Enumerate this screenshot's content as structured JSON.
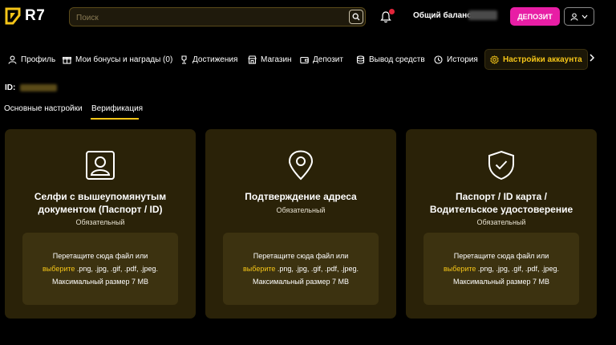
{
  "header": {
    "logo_text": "R7",
    "search_placeholder": "Поиск",
    "balance_label": "Общий баланс:",
    "deposit_label": "ДЕПОЗИТ"
  },
  "nav": {
    "items": [
      {
        "label": "Профиль",
        "icon": "user-icon"
      },
      {
        "label": "Мои бонусы и награды (0)",
        "icon": "gift-icon"
      },
      {
        "label": "Достижения",
        "icon": "trophy-icon"
      },
      {
        "label": "Магазин",
        "icon": "shop-icon"
      },
      {
        "label": "Депозит",
        "icon": "wallet-icon"
      },
      {
        "label": "Вывод средств",
        "icon": "coins-icon"
      },
      {
        "label": "История",
        "icon": "history-icon"
      },
      {
        "label": "Настройки аккаунта",
        "icon": "settings-icon",
        "active": true
      }
    ]
  },
  "account": {
    "id_label": "ID:"
  },
  "tabs": [
    {
      "label": "Основные настройки",
      "active": false
    },
    {
      "label": "Верификация",
      "active": true
    }
  ],
  "cards": [
    {
      "icon": "selfie-icon",
      "title_line1": "Селфи с вышеупомянутым",
      "title_line2": "документом (Паспорт / ID)",
      "required": "Обязательный"
    },
    {
      "icon": "location-pin-icon",
      "title_line1": "Подтверждение адреса",
      "title_line2": "",
      "required": "Обязательный"
    },
    {
      "icon": "shield-check-icon",
      "title_line1": "Паспорт / ID карта /",
      "title_line2": "Водительское удостоверение",
      "required": "Обязательный"
    }
  ],
  "dropzone": {
    "line1": "Перетащите сюда файл или",
    "choose": "выберите",
    "formats": " .png, .jpg, .gif, .pdf, .jpeg.",
    "max_size": "Максимальный размер 7 MB"
  },
  "colors": {
    "accent": "#f5c518",
    "deposit": "#e81ea5",
    "card_bg": "#2a2208",
    "dropzone_bg": "#3c3210"
  }
}
